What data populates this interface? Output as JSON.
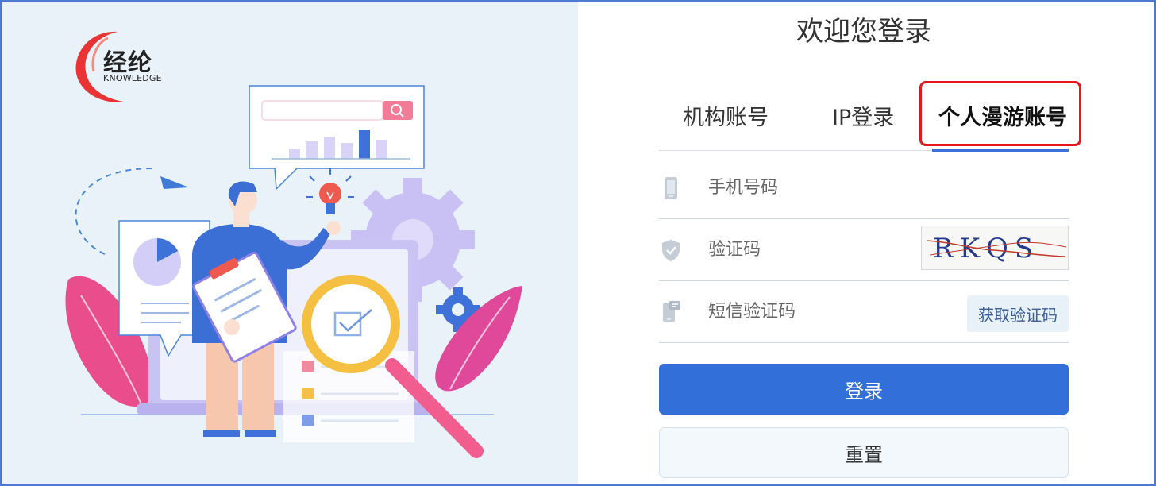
{
  "logo": {
    "cn": "经纶",
    "en": "KNOWLEDGE"
  },
  "login": {
    "title": "欢迎您登录",
    "tabs": [
      {
        "label": "机构账号"
      },
      {
        "label": "IP登录"
      },
      {
        "label": "个人漫游账号",
        "active": true
      }
    ],
    "fields": {
      "phone_placeholder": "手机号码",
      "captcha_placeholder": "验证码",
      "sms_placeholder": "短信验证码"
    },
    "captcha_text": "RKQS",
    "sms_button": "获取验证码",
    "login_button": "登录",
    "reset_button": "重置"
  },
  "icons": {
    "phone": "phone-icon",
    "shield": "shield-icon",
    "sms": "sms-phone-icon"
  },
  "colors": {
    "primary": "#336fd9",
    "highlight": "#e8161b",
    "panel_bg": "#eaf2f9"
  }
}
